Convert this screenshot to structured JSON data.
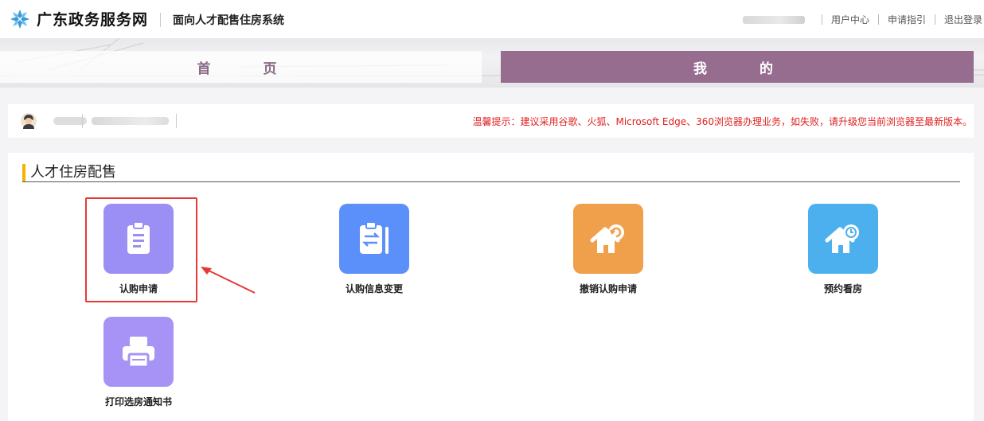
{
  "header": {
    "brand": "广东政务服务网",
    "system_name": "面向人才配售住房系统",
    "links": [
      "用户中心",
      "申请指引",
      "退出登录"
    ]
  },
  "nav": {
    "tabs": [
      {
        "label": "首 页",
        "active": false
      },
      {
        "label": "我 的",
        "active": true
      }
    ]
  },
  "info": {
    "tip": "温馨提示：建议采用谷歌、火狐、Microsoft Edge、360浏览器办理业务，如失败，请升级您当前浏览器至最新版本。"
  },
  "section": {
    "title": "人才住房配售",
    "services": [
      {
        "label": "认购申请",
        "icon": "clipboard-icon",
        "color": "#9b8ef5",
        "highlighted": true
      },
      {
        "label": "认购信息变更",
        "icon": "exchange-clipboard-icon",
        "color": "#5b8ff9"
      },
      {
        "label": "撤销认购申请",
        "icon": "house-undo-icon",
        "color": "#f0a04b"
      },
      {
        "label": "预约看房",
        "icon": "house-clock-icon",
        "color": "#4db0ee"
      },
      {
        "label": "打印选房通知书",
        "icon": "printer-icon",
        "color": "#a793f5"
      }
    ]
  },
  "colors": {
    "active_tab": "#966c8f",
    "tip_text": "#e02020",
    "title_accent": "#f5b400",
    "highlight": "#e53935"
  }
}
